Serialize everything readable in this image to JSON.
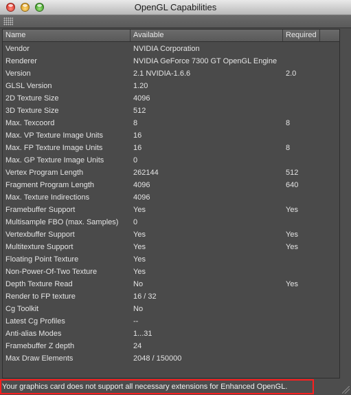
{
  "window": {
    "title": "OpenGL Capabilities"
  },
  "table": {
    "columns": [
      "Name",
      "Available",
      "Required"
    ],
    "rows": [
      {
        "name": "Vendor",
        "available": "NVIDIA Corporation",
        "required": ""
      },
      {
        "name": "Renderer",
        "available": "NVIDIA GeForce 7300 GT OpenGL Engine",
        "required": ""
      },
      {
        "name": "Version",
        "available": "2.1 NVIDIA-1.6.6",
        "required": "2.0"
      },
      {
        "name": "GLSL Version",
        "available": "1.20",
        "required": ""
      },
      {
        "name": "2D Texture Size",
        "available": "4096",
        "required": ""
      },
      {
        "name": "3D Texture Size",
        "available": "512",
        "required": ""
      },
      {
        "name": "Max. Texcoord",
        "available": "8",
        "required": "8"
      },
      {
        "name": "Max. VP Texture Image Units",
        "available": "16",
        "required": ""
      },
      {
        "name": "Max. FP Texture Image Units",
        "available": "16",
        "required": "8"
      },
      {
        "name": "Max. GP Texture Image Units",
        "available": "0",
        "required": ""
      },
      {
        "name": "Vertex Program Length",
        "available": "262144",
        "required": "512"
      },
      {
        "name": "Fragment Program Length",
        "available": "4096",
        "required": "640"
      },
      {
        "name": "Max. Texture Indirections",
        "available": "4096",
        "required": ""
      },
      {
        "name": "Framebuffer Support",
        "available": "Yes",
        "required": "Yes"
      },
      {
        "name": "Multisample FBO (max. Samples)",
        "available": "0",
        "required": ""
      },
      {
        "name": "Vertexbuffer Support",
        "available": "Yes",
        "required": "Yes"
      },
      {
        "name": "Multitexture Support",
        "available": "Yes",
        "required": "Yes"
      },
      {
        "name": "Floating Point Texture",
        "available": "Yes",
        "required": ""
      },
      {
        "name": "Non-Power-Of-Two Texture",
        "available": "Yes",
        "required": ""
      },
      {
        "name": "Depth Texture Read",
        "available": "No",
        "required": "Yes"
      },
      {
        "name": "Render to FP texture",
        "available": "16 / 32",
        "required": ""
      },
      {
        "name": "Cg Toolkit",
        "available": "No",
        "required": ""
      },
      {
        "name": "Latest Cg Profiles",
        "available": "--",
        "required": ""
      },
      {
        "name": "Anti-alias Modes",
        "available": "1...31",
        "required": ""
      },
      {
        "name": "Framebuffer Z depth",
        "available": "24",
        "required": ""
      },
      {
        "name": "Max Draw Elements",
        "available": "2048 / 150000",
        "required": ""
      }
    ]
  },
  "status": {
    "message": "Your graphics card does not support all necessary extensions for Enhanced OpenGL."
  }
}
